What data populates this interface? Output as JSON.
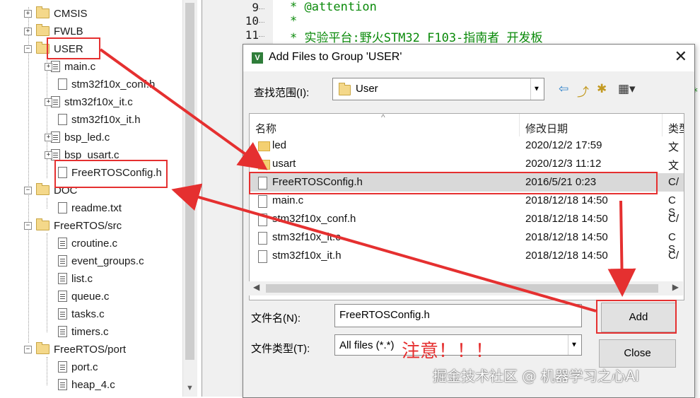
{
  "tree": {
    "nodes": [
      {
        "label": "CMSIS",
        "type": "folder"
      },
      {
        "label": "FWLB",
        "type": "folder"
      },
      {
        "label": "USER",
        "type": "folder"
      },
      {
        "label": "main.c",
        "type": "file"
      },
      {
        "label": "stm32f10x_conf.h",
        "type": "file"
      },
      {
        "label": "stm32f10x_it.c",
        "type": "file"
      },
      {
        "label": "stm32f10x_it.h",
        "type": "file"
      },
      {
        "label": "bsp_led.c",
        "type": "file"
      },
      {
        "label": "bsp_usart.c",
        "type": "file"
      },
      {
        "label": "FreeRTOSConfig.h",
        "type": "file"
      },
      {
        "label": "DOC",
        "type": "folder"
      },
      {
        "label": "readme.txt",
        "type": "file"
      },
      {
        "label": "FreeRTOS/src",
        "type": "folder"
      },
      {
        "label": "croutine.c",
        "type": "file"
      },
      {
        "label": "event_groups.c",
        "type": "file"
      },
      {
        "label": "list.c",
        "type": "file"
      },
      {
        "label": "queue.c",
        "type": "file"
      },
      {
        "label": "tasks.c",
        "type": "file"
      },
      {
        "label": "timers.c",
        "type": "file"
      },
      {
        "label": "FreeRTOS/port",
        "type": "folder"
      },
      {
        "label": "port.c",
        "type": "file"
      },
      {
        "label": "heap_4.c",
        "type": "file"
      }
    ]
  },
  "editor": {
    "lines": [
      {
        "num": "9",
        "text": "* @attention"
      },
      {
        "num": "10",
        "text": "*"
      },
      {
        "num": "11",
        "text": "* 实验平台:野火STM32 F103-指南者 开发板"
      }
    ],
    "stray": "*"
  },
  "dialog": {
    "title": "Add Files to Group 'USER'",
    "close_glyph": "✕",
    "app_icon": "V",
    "look_in_label": "查找范围(I):",
    "look_in_value": "User",
    "columns": [
      "名称",
      "修改日期",
      "类型"
    ],
    "header_third_visible": "类型",
    "files": [
      {
        "name": "led",
        "date": "2020/12/2 17:59",
        "type": "文",
        "kind": "folder"
      },
      {
        "name": "usart",
        "date": "2020/12/3 11:12",
        "type": "文",
        "kind": "folder"
      },
      {
        "name": "FreeRTOSConfig.h",
        "date": "2016/5/21 0:23",
        "type": "C/",
        "kind": "file"
      },
      {
        "name": "main.c",
        "date": "2018/12/18 14:50",
        "type": "C S",
        "kind": "file"
      },
      {
        "name": "stm32f10x_conf.h",
        "date": "2018/12/18 14:50",
        "type": "C/",
        "kind": "file"
      },
      {
        "name": "stm32f10x_it.c",
        "date": "2018/12/18 14:50",
        "type": "C S",
        "kind": "file"
      },
      {
        "name": "stm32f10x_it.h",
        "date": "2018/12/18 14:50",
        "type": "C/",
        "kind": "file"
      }
    ],
    "filename_label": "文件名(N):",
    "filename_value": "FreeRTOSConfig.h",
    "filetype_label": "文件类型(T):",
    "filetype_value": "All files (*.*)",
    "add_button": "Add",
    "close_button": "Close"
  },
  "annotations": {
    "notice": "注意！！！",
    "watermark": "掘金技术社区 @ 机器学习之心AI"
  },
  "colors": {
    "annotation_red": "#e53030",
    "comment_green": "#0a8a0a"
  }
}
